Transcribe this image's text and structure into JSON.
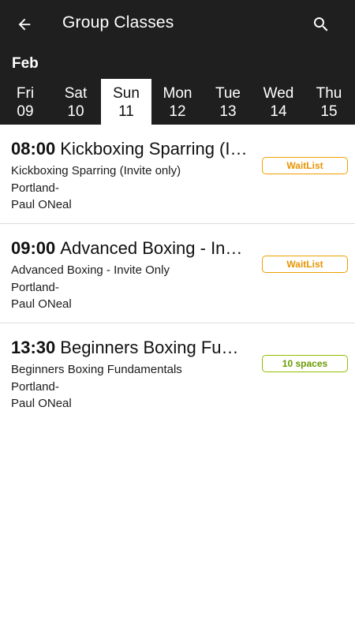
{
  "appbar": {
    "title": "Group Classes",
    "back_icon": "arrow-back-icon",
    "search_icon": "search-icon"
  },
  "month": "Feb",
  "days": [
    {
      "name": "Fri",
      "num": "09",
      "selected": false
    },
    {
      "name": "Sat",
      "num": "10",
      "selected": false
    },
    {
      "name": "Sun",
      "num": "11",
      "selected": true
    },
    {
      "name": "Mon",
      "num": "12",
      "selected": false
    },
    {
      "name": "Tue",
      "num": "13",
      "selected": false
    },
    {
      "name": "Wed",
      "num": "14",
      "selected": false
    },
    {
      "name": "Thu",
      "num": "15",
      "selected": false
    }
  ],
  "classes": [
    {
      "time": "08:00",
      "title": "Kickboxing Sparring (Invite only)",
      "name": "Kickboxing Sparring (Invite only)",
      "location": "Portland-",
      "instructor": "Paul ONeal",
      "status": "WaitList",
      "status_type": "wait"
    },
    {
      "time": "09:00",
      "title": "Advanced Boxing - Invite Only",
      "name": "Advanced Boxing - Invite Only",
      "location": "Portland-",
      "instructor": "Paul ONeal",
      "status": "WaitList",
      "status_type": "wait"
    },
    {
      "time": "13:30",
      "title": "Beginners Boxing Fundamentals",
      "name": "Beginners Boxing Fundamentals",
      "location": "Portland-",
      "instructor": "Paul ONeal",
      "status": "10 spaces",
      "status_type": "spaces"
    }
  ],
  "colors": {
    "header_bg": "#1f1f1f",
    "waitlist": "#f0a000",
    "spaces": "#8fbf00"
  }
}
